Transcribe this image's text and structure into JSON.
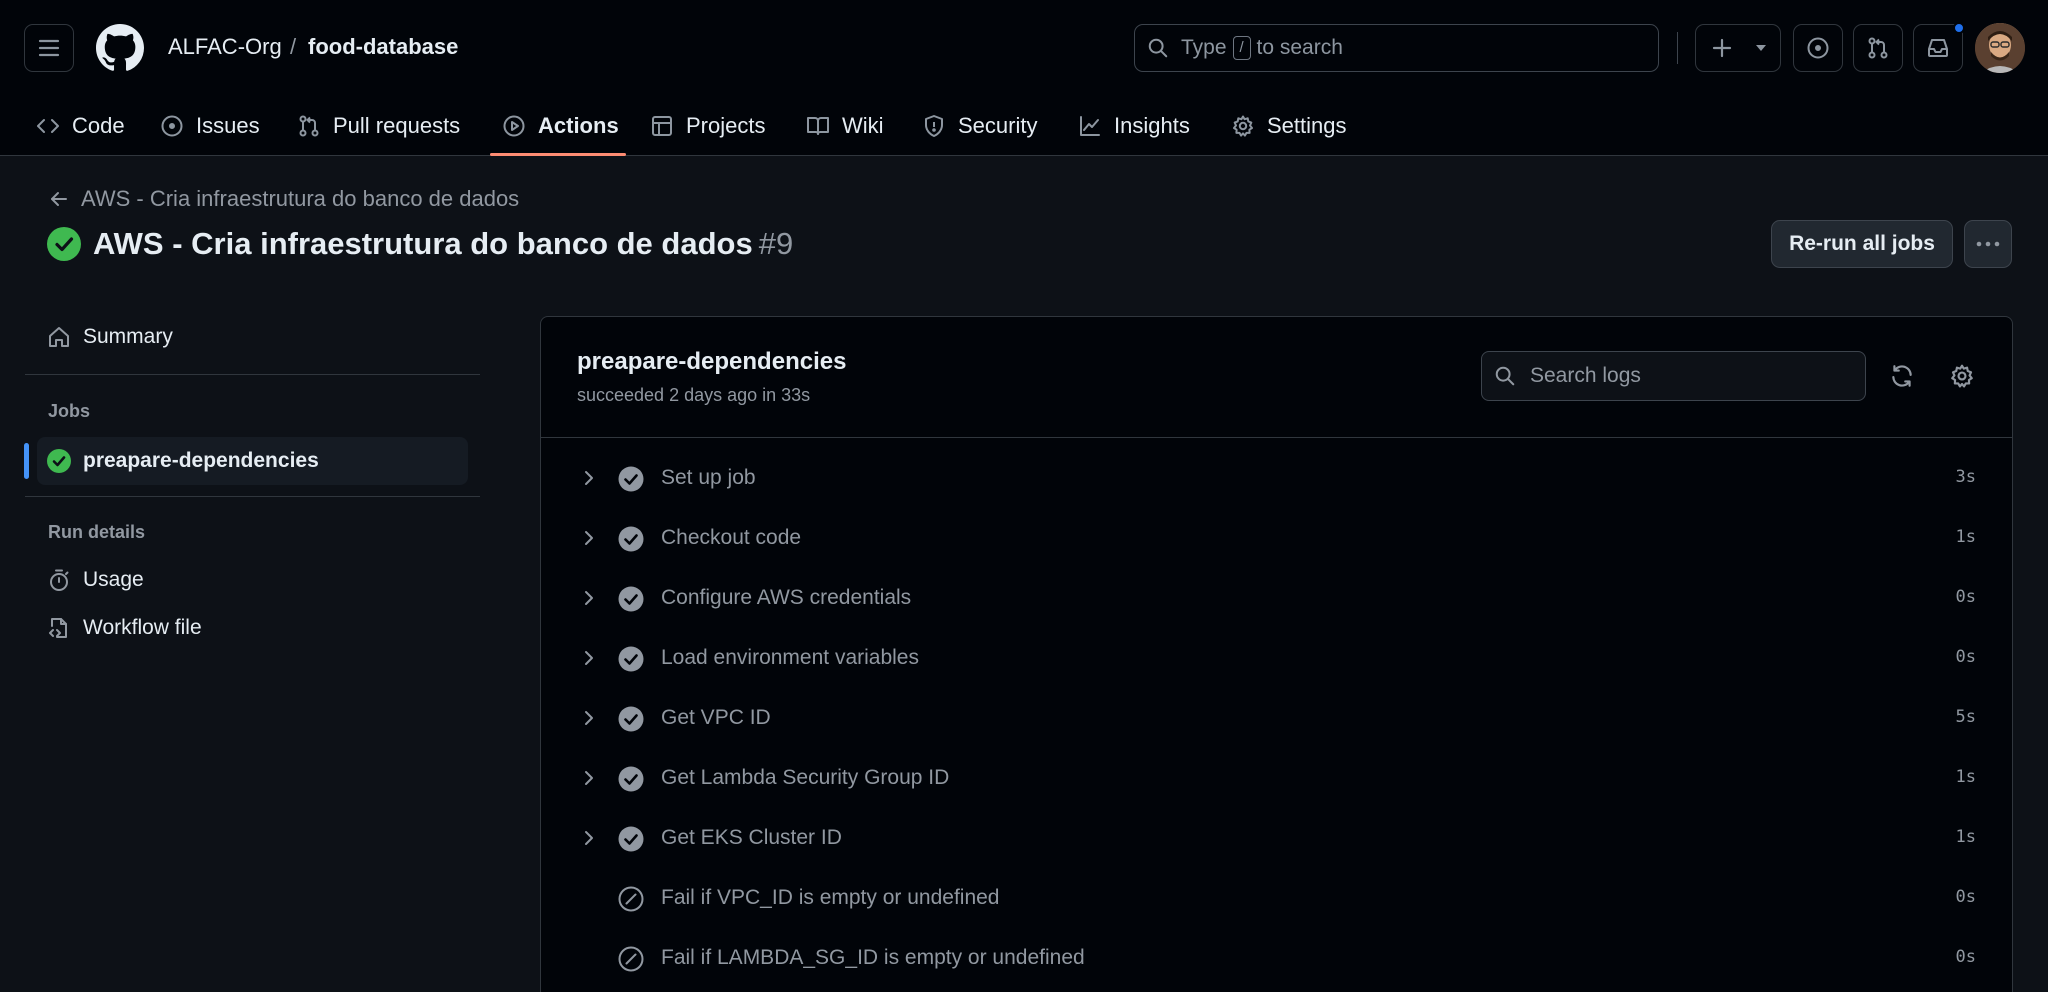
{
  "header": {
    "org": "ALFAC-Org",
    "separator": "/",
    "repo": "food-database",
    "search": {
      "prefix": "Type",
      "key": "/",
      "suffix": "to search"
    },
    "nav": [
      {
        "label": "Code",
        "icon": "code-icon"
      },
      {
        "label": "Issues",
        "icon": "issue-opened-icon"
      },
      {
        "label": "Pull requests",
        "icon": "git-pull-request-icon"
      },
      {
        "label": "Actions",
        "icon": "play-icon",
        "active": true
      },
      {
        "label": "Projects",
        "icon": "table-icon"
      },
      {
        "label": "Wiki",
        "icon": "book-icon"
      },
      {
        "label": "Security",
        "icon": "shield-icon"
      },
      {
        "label": "Insights",
        "icon": "graph-icon"
      },
      {
        "label": "Settings",
        "icon": "gear-icon"
      }
    ],
    "accent": "#fd8c73"
  },
  "run": {
    "back_label": "AWS - Cria infraestrutura do banco de dados",
    "title": "AWS - Cria infraestrutura do banco de dados",
    "number": "#9",
    "rerun_label": "Re-run all jobs",
    "status_color": "#3fb950"
  },
  "sidebar": {
    "summary_label": "Summary",
    "jobs_heading": "Jobs",
    "active_job": "preapare-dependencies",
    "run_details_heading": "Run details",
    "usage_label": "Usage",
    "workflow_file_label": "Workflow file"
  },
  "job": {
    "title": "preapare-dependencies",
    "subtitle": "succeeded 2 days ago in 33s",
    "search_placeholder": "Search logs",
    "steps": [
      {
        "name": "Set up job",
        "duration": "3s",
        "status": "success",
        "expandable": true
      },
      {
        "name": "Checkout code",
        "duration": "1s",
        "status": "success",
        "expandable": true
      },
      {
        "name": "Configure AWS credentials",
        "duration": "0s",
        "status": "success",
        "expandable": true
      },
      {
        "name": "Load environment variables",
        "duration": "0s",
        "status": "success",
        "expandable": true
      },
      {
        "name": "Get VPC ID",
        "duration": "5s",
        "status": "success",
        "expandable": true
      },
      {
        "name": "Get Lambda Security Group ID",
        "duration": "1s",
        "status": "success",
        "expandable": true
      },
      {
        "name": "Get EKS Cluster ID",
        "duration": "1s",
        "status": "success",
        "expandable": true
      },
      {
        "name": "Fail if VPC_ID is empty or undefined",
        "duration": "0s",
        "status": "skipped",
        "expandable": false
      },
      {
        "name": "Fail if LAMBDA_SG_ID is empty or undefined",
        "duration": "0s",
        "status": "skipped",
        "expandable": false
      }
    ]
  }
}
